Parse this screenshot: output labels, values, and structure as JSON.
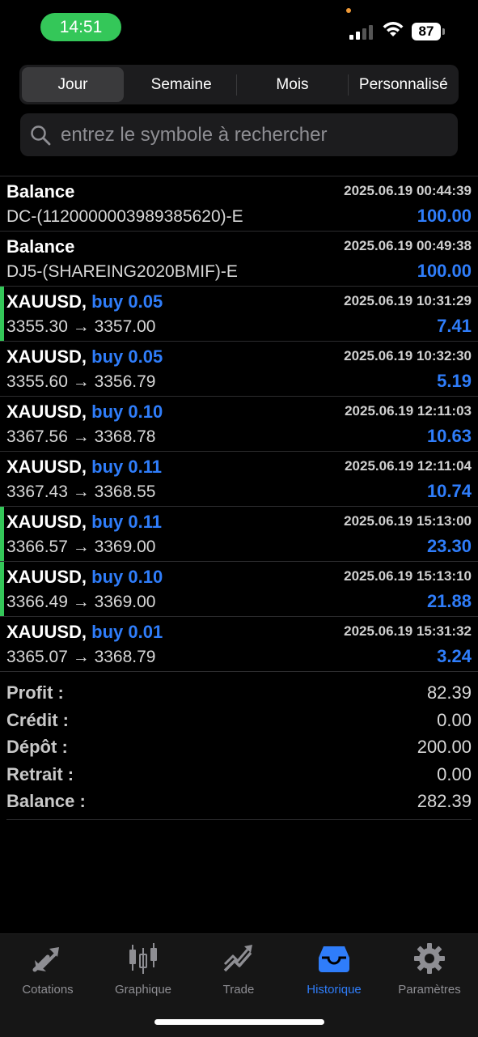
{
  "status_bar": {
    "time": "14:51",
    "battery": "87"
  },
  "tabs_period": [
    {
      "label": "Jour",
      "active": true
    },
    {
      "label": "Semaine",
      "active": false
    },
    {
      "label": "Mois",
      "active": false
    },
    {
      "label": "Personnalisé",
      "active": false
    }
  ],
  "search": {
    "placeholder": "entrez le symbole à rechercher"
  },
  "deals": [
    {
      "title": "Balance",
      "side": "",
      "datetime": "2025.06.19 00:44:39",
      "subtitle": "DC-(1120000003989385620)-E",
      "amount": "100.00",
      "marker": false
    },
    {
      "title": "Balance",
      "side": "",
      "datetime": "2025.06.19 00:49:38",
      "subtitle": "DJ5-(SHAREING2020BMIF)-E",
      "amount": "100.00",
      "marker": false
    },
    {
      "title": "XAUUSD,",
      "side": "buy 0.05",
      "datetime": "2025.06.19 10:31:29",
      "subtitle": "3355.30 → 3357.00",
      "amount": "7.41",
      "marker": true
    },
    {
      "title": "XAUUSD,",
      "side": "buy 0.05",
      "datetime": "2025.06.19 10:32:30",
      "subtitle": "3355.60 → 3356.79",
      "amount": "5.19",
      "marker": false
    },
    {
      "title": "XAUUSD,",
      "side": "buy 0.10",
      "datetime": "2025.06.19 12:11:03",
      "subtitle": "3367.56 → 3368.78",
      "amount": "10.63",
      "marker": false
    },
    {
      "title": "XAUUSD,",
      "side": "buy 0.11",
      "datetime": "2025.06.19 12:11:04",
      "subtitle": "3367.43 → 3368.55",
      "amount": "10.74",
      "marker": false
    },
    {
      "title": "XAUUSD,",
      "side": "buy 0.11",
      "datetime": "2025.06.19 15:13:00",
      "subtitle": "3366.57 → 3369.00",
      "amount": "23.30",
      "marker": true
    },
    {
      "title": "XAUUSD,",
      "side": "buy 0.10",
      "datetime": "2025.06.19 15:13:10",
      "subtitle": "3366.49 → 3369.00",
      "amount": "21.88",
      "marker": true
    },
    {
      "title": "XAUUSD,",
      "side": "buy 0.01",
      "datetime": "2025.06.19 15:31:32",
      "subtitle": "3365.07 → 3368.79",
      "amount": "3.24",
      "marker": false
    }
  ],
  "summary": [
    {
      "label": "Profit :",
      "value": "82.39"
    },
    {
      "label": "Crédit :",
      "value": "0.00"
    },
    {
      "label": "Dépôt :",
      "value": "200.00"
    },
    {
      "label": "Retrait :",
      "value": "0.00"
    },
    {
      "label": "Balance :",
      "value": "282.39"
    }
  ],
  "tab_bar": [
    {
      "label": "Cotations",
      "icon": "quotes-arrows-icon",
      "active": false
    },
    {
      "label": "Graphique",
      "icon": "candlestick-chart-icon",
      "active": false
    },
    {
      "label": "Trade",
      "icon": "trade-trend-icon",
      "active": false
    },
    {
      "label": "Historique",
      "icon": "history-inbox-icon",
      "active": true
    },
    {
      "label": "Paramètres",
      "icon": "gear-icon",
      "active": false
    }
  ],
  "colors": {
    "accent": "#2f7dfa",
    "green": "#34c759",
    "background": "#000000"
  }
}
